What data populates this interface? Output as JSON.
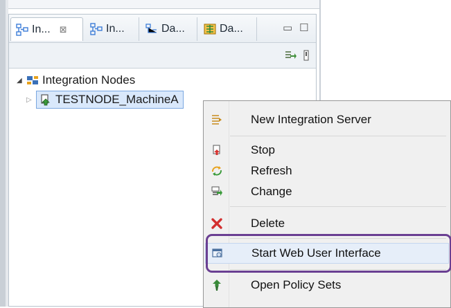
{
  "tabs": [
    {
      "label": "In...",
      "icon": "integration-nodes-icon",
      "close": "⊠"
    },
    {
      "label": "In...",
      "icon": "integration-nodes-icon"
    },
    {
      "label": "Da...",
      "icon": "data-icon"
    },
    {
      "label": "Da...",
      "icon": "data-capture-icon"
    }
  ],
  "window_controls": {
    "minimize": "▭",
    "maximize": "☐"
  },
  "tree": {
    "root_label": "Integration Nodes",
    "node_label": "TESTNODE_MachineA"
  },
  "context_menu": {
    "items": [
      {
        "label": "New Integration Server",
        "icon": "new-server-icon"
      },
      {
        "label": "Stop",
        "icon": "stop-icon"
      },
      {
        "label": "Refresh",
        "icon": "refresh-icon"
      },
      {
        "label": "Change",
        "icon": "change-icon"
      },
      {
        "label": "Delete",
        "icon": "delete-icon"
      },
      {
        "label": "Start Web User Interface",
        "icon": "web-ui-icon"
      },
      {
        "label": "Open Policy Sets",
        "icon": "policy-sets-icon"
      }
    ]
  },
  "colors": {
    "highlight_outline": "#6a3f92",
    "delete_red": "#d32f2f"
  }
}
